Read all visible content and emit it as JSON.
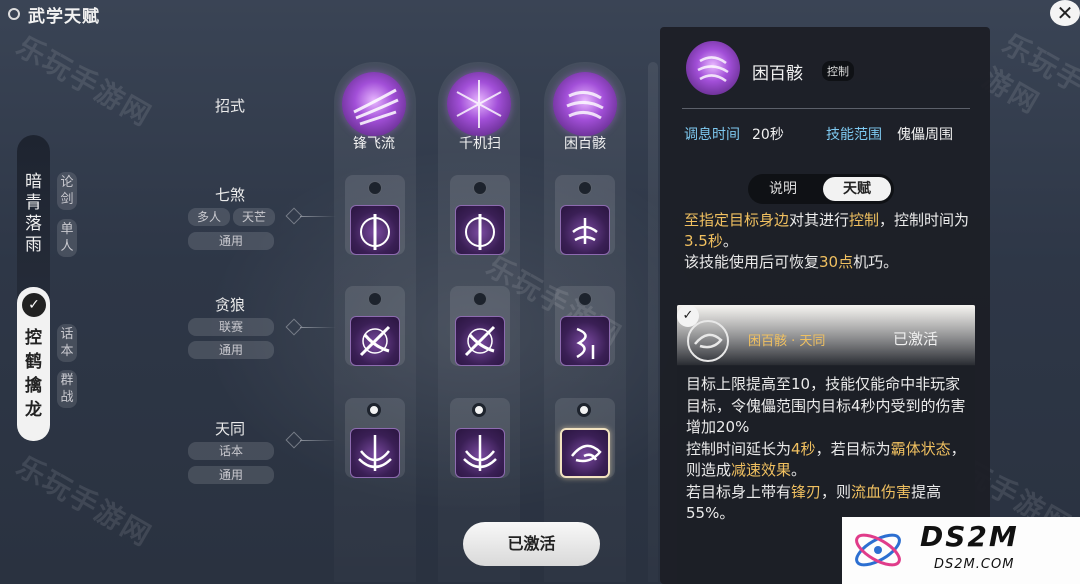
{
  "header": {
    "title": "武学天赋"
  },
  "left_tabs": {
    "items": [
      {
        "name": "暗青落雨",
        "tags": [
          "论剑",
          "单人"
        ],
        "selected": false
      },
      {
        "name": "控鹤擒龙",
        "tags": [
          "话本",
          "群战"
        ],
        "selected": true
      }
    ]
  },
  "rows": {
    "header_label": "招式",
    "items": [
      {
        "label": "七煞",
        "tags": [
          "多人",
          "天芒",
          "通用"
        ]
      },
      {
        "label": "贪狼",
        "tags": [
          "联赛",
          "通用"
        ]
      },
      {
        "label": "天同",
        "tags": [
          "话本",
          "通用"
        ]
      }
    ]
  },
  "skills": [
    {
      "name": "锋飞流",
      "slots_active": [
        false,
        false,
        true
      ]
    },
    {
      "name": "千机扫",
      "slots_active": [
        false,
        false,
        true
      ]
    },
    {
      "name": "困百骸",
      "slots_active": [
        false,
        false,
        true
      ]
    }
  ],
  "activate_button": {
    "label": "已激活"
  },
  "detail": {
    "name": "困百骸",
    "type": "控制",
    "stats": [
      {
        "key": "调息时间",
        "value": "20秒"
      },
      {
        "key": "技能范围",
        "value": "傀儡周围"
      }
    ],
    "tabs": [
      "说明",
      "天赋"
    ],
    "active_tab": "天赋",
    "desc": {
      "p1_gold": "至指定目标身边",
      "p2": "对其进行",
      "p3_gold": "控制",
      "p4": "，控制时间为",
      "p5_gold": "3.5秒",
      "p6": "。",
      "p7": "该技能使用后可恢复",
      "p8_gold": "30点",
      "p9": "机巧。"
    },
    "talent": {
      "title": "困百骸 · 天同",
      "status": "已激活",
      "t1": "目标上限提高至10，技能仅能命中非玩家目标，令傀儡范围内目标4秒内受到的伤害增加20%",
      "t2": "控制时间延长为",
      "t3_gold": "4秒",
      "t4": "，若目标为",
      "t5_gold": "霸体状态",
      "t6": "，则造成",
      "t7_gold": "减速效果",
      "t8": "。",
      "t9": "若目标身上带有",
      "t10_gold": "锋刃",
      "t11": "，则",
      "t12_gold": "流血伤害",
      "t13": "提高55%。"
    }
  },
  "watermark": {
    "text": "乐玩手游网"
  },
  "logo": {
    "main": "DS2M",
    "sub": "DS2M.COM"
  },
  "colors": {
    "accent_gold": "#f0c060",
    "stat_blue": "#7ec9f0",
    "talent_purple": "#a24fd8"
  }
}
